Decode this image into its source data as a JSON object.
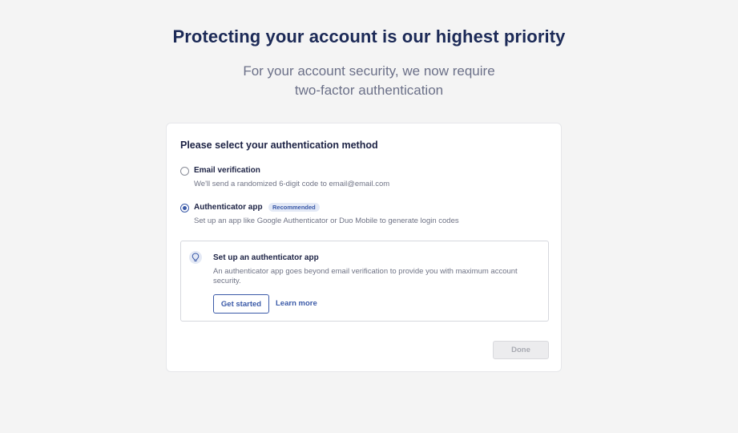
{
  "header": {
    "title": "Protecting your account is our highest priority",
    "subtitle_line1": "For your account security, we now require",
    "subtitle_line2": "two-factor authentication"
  },
  "card": {
    "heading": "Please select your authentication method",
    "options": [
      {
        "label": "Email verification",
        "description": "We'll send a randomized 6-digit code to email@email.com",
        "selected": false
      },
      {
        "label": "Authenticator app",
        "badge": "Recommended",
        "description": "Set up an app like Google Authenticator or Duo Mobile to generate login codes",
        "selected": true
      }
    ],
    "info_box": {
      "icon": "lightbulb-icon",
      "title": "Set up an authenticator app",
      "description": "An authenticator app goes beyond email verification to provide you with maximum account security.",
      "primary_button": "Get started",
      "link": "Learn more"
    },
    "done_button": "Done"
  },
  "colors": {
    "accent": "#3b5aa8",
    "title": "#1c2a57",
    "muted_text": "#6f7385",
    "background": "#f4f4f4"
  }
}
